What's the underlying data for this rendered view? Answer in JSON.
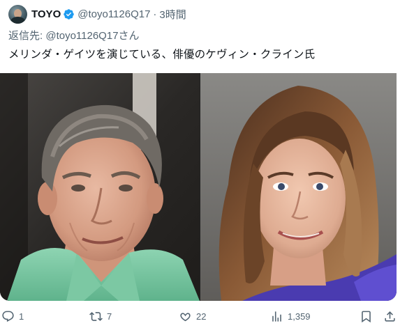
{
  "author": {
    "name": "TOYO",
    "handle": "@toyo1126Q17",
    "separator": "·",
    "time": "3時間"
  },
  "reply": {
    "prefix": "返信先:",
    "mention": "@toyo1126Q17さん"
  },
  "tweet_text": "メリンダ・ゲイツを演じている、俳優のケヴィン・クライン氏",
  "actions": {
    "replies": "1",
    "retweets": "7",
    "likes": "22",
    "views": "1,359"
  },
  "colors": {
    "text": "#0f1419",
    "muted": "#536471",
    "verified": "#1d9bf0"
  },
  "icons": [
    "verified-badge-icon",
    "reply-icon",
    "retweet-icon",
    "like-icon",
    "views-icon",
    "bookmark-icon",
    "share-icon"
  ]
}
